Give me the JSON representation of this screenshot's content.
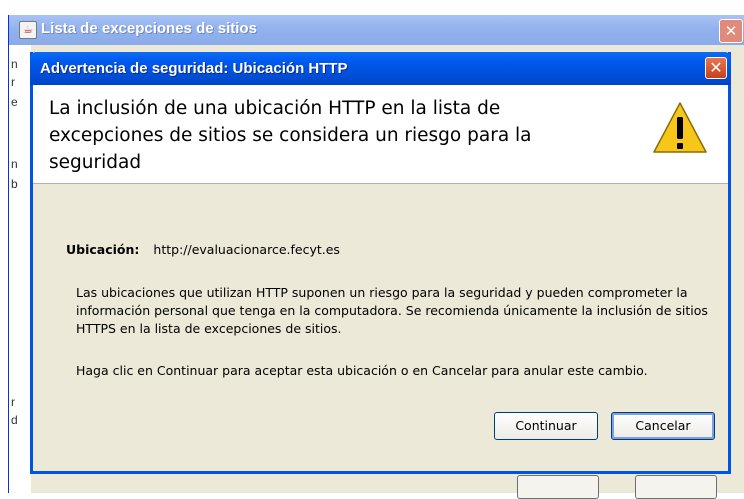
{
  "background_window": {
    "title": "Lista de excepciones de sitios",
    "close_glyph": "✕",
    "left_glyphs": [
      "n",
      "r",
      "e",
      "n",
      "b",
      "r",
      "d"
    ]
  },
  "dialog": {
    "title": "Advertencia de seguridad: Ubicación HTTP",
    "close_glyph": "✕",
    "header_text": "La inclusión de una ubicación HTTP en la lista de excepciones de sitios se considera un riesgo para la seguridad",
    "location_label": "Ubicación:",
    "location_value": "http://evaluacionarce.fecyt.es",
    "paragraph1": "Las ubicaciones que utilizan HTTP suponen un riesgo para la seguridad y pueden comprometer la información personal que tenga en la computadora. Se recomienda únicamente la inclusión de sitios HTTPS en la lista de excepciones de sitios.",
    "paragraph2": "Haga clic en Continuar para aceptar esta ubicación o en Cancelar para anular este cambio.",
    "continue_label": "Continuar",
    "cancel_label": "Cancelar"
  },
  "colors": {
    "titlebar": "#0054e3",
    "dialog_bg": "#ece9d8",
    "warning_yellow": "#f6c71a"
  }
}
